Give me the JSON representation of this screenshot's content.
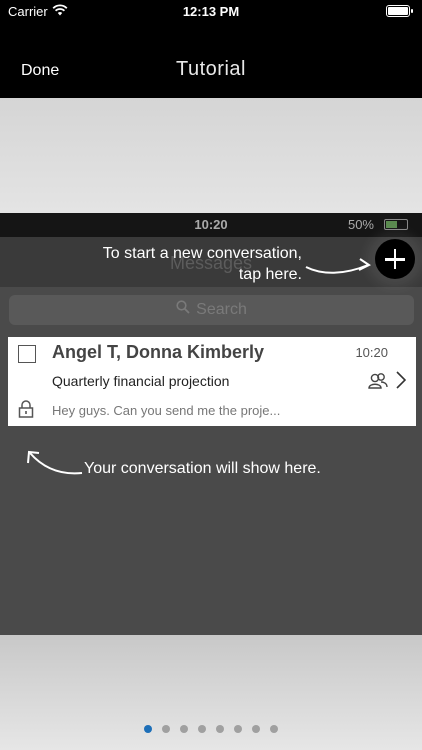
{
  "status_bar": {
    "carrier": "Carrier",
    "time": "12:13 PM"
  },
  "nav": {
    "done_label": "Done",
    "title": "Tutorial"
  },
  "tutorial": {
    "mini_status": {
      "time": "10:20",
      "battery": "50%"
    },
    "header_ghost_title": "Messages",
    "search_placeholder": "Search",
    "hint_new_line1": "To start a new conversation,",
    "hint_new_line2": "tap here.",
    "conversation": {
      "name": "Angel T, Donna Kimberly",
      "time": "10:20",
      "subject": "Quarterly financial projection",
      "preview": "Hey guys. Can you send me the proje..."
    },
    "hint_conversation": "Your conversation will show here."
  },
  "pager": {
    "count": 8,
    "active_index": 0
  },
  "colors": {
    "accent": "#1d6fb8",
    "bar": "#000000",
    "tutorial_bg": "#4a4a4a"
  }
}
